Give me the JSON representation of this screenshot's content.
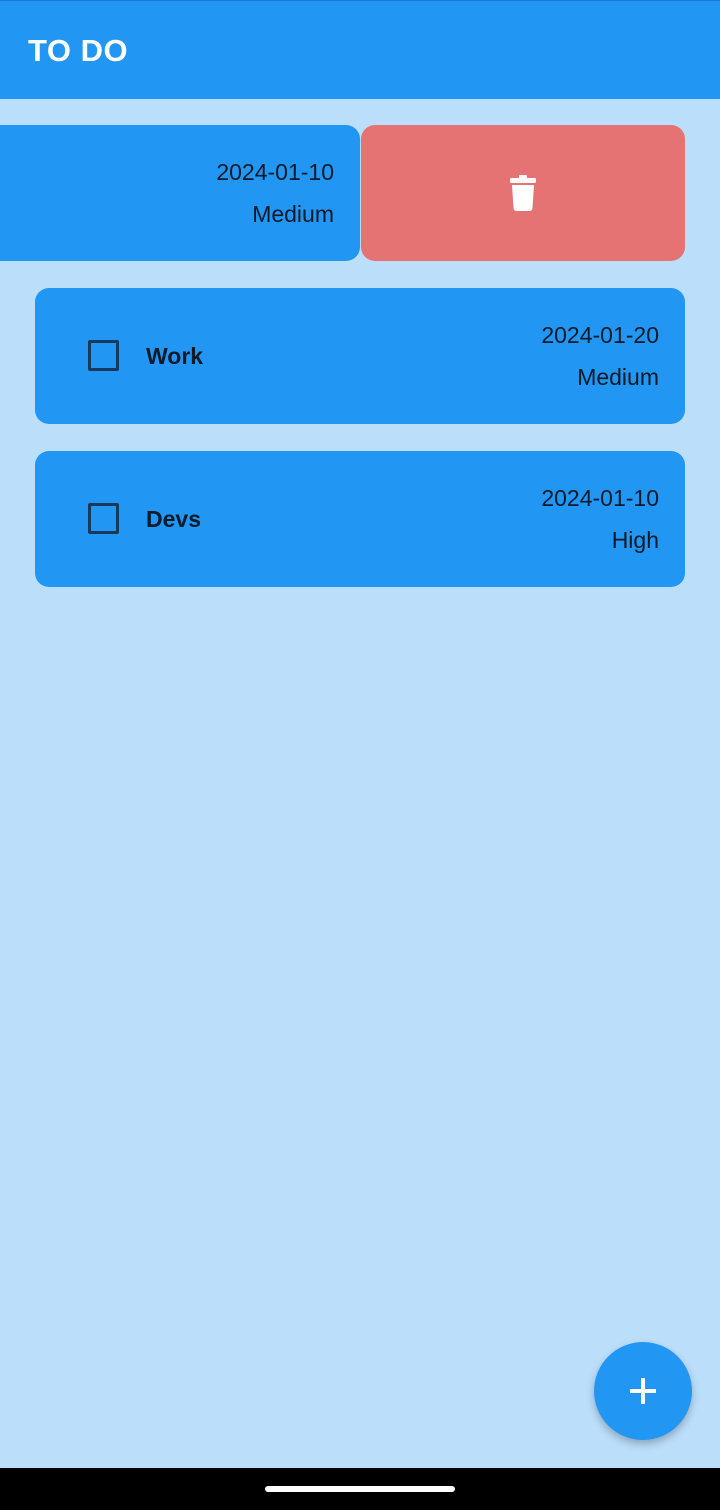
{
  "app_bar": {
    "title": "TO DO"
  },
  "tasks": [
    {
      "title": "",
      "date": "2024-01-10",
      "priority": "Medium",
      "checked": false,
      "swiped": true
    },
    {
      "title": "Work",
      "date": "2024-01-20",
      "priority": "Medium",
      "checked": false,
      "swiped": false
    },
    {
      "title": "Devs",
      "date": "2024-01-10",
      "priority": "High",
      "checked": false,
      "swiped": false
    }
  ],
  "icons": {
    "delete": "trash-icon",
    "add": "plus-icon"
  },
  "colors": {
    "primary": "#2196f3",
    "background": "#bbdefa",
    "delete": "#e57373",
    "text_dark": "#0c1a2a",
    "title_text": "#ffffff"
  }
}
